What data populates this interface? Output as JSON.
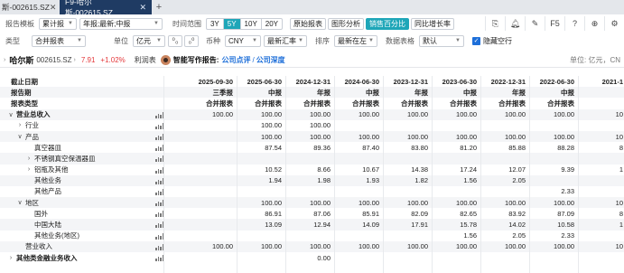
{
  "tabs": [
    {
      "label": "斯-002615.SZ",
      "active": false
    },
    {
      "label": "F9-哈尔斯-002615.SZ",
      "active": true
    }
  ],
  "toolbar1": {
    "report_template_label": "报告模板",
    "template_value": "累计报",
    "period_value": "年报;最新;中报",
    "time_range_label": "时间范围",
    "ranges": [
      "3Y",
      "5Y",
      "10Y",
      "20Y"
    ],
    "active_range": "5Y",
    "views": [
      "原始报表",
      "图形分析",
      "销售百分比",
      "同比增长率"
    ],
    "active_view": "销售百分比",
    "icons": [
      "save-icon",
      "bell-icon",
      "edit-icon",
      "F5",
      "help-icon",
      "plus-icon",
      "settings-icon"
    ],
    "f5_label": "F5"
  },
  "toolbar2": {
    "type_label": "类型",
    "type_value": "合并报表",
    "unit_label": "单位",
    "unit_value": "亿元",
    "currency_label": "币种",
    "currency_value": "CNY",
    "rate_value": "最新汇率",
    "sort_label": "排序",
    "sort_value": "最新在左",
    "format_label": "数据表格",
    "format_value": "默认",
    "hide_empty_label": "隐藏空行",
    "hide_empty_checked": true
  },
  "stock": {
    "name": "哈尔斯",
    "code": "002615.SZ",
    "price": "7.91",
    "change_pct": "+1.02%",
    "profit_table": "利润表",
    "ai_title": "智能写作报告:",
    "link1": "公司点评",
    "link2": "公司深度",
    "unit_text": "单位: 亿元，CN"
  },
  "table": {
    "columns": [
      "2025-09-30",
      "2025-06-30",
      "2024-12-31",
      "2024-06-30",
      "2023-12-31",
      "2023-06-30",
      "2022-12-31",
      "2022-06-30",
      "2021-1"
    ],
    "rows": [
      {
        "label": "截止日期",
        "header": true,
        "cells": [
          "2025-09-30",
          "2025-06-30",
          "2024-12-31",
          "2024-06-30",
          "2023-12-31",
          "2023-06-30",
          "2022-12-31",
          "2022-06-30",
          "2021-1"
        ]
      },
      {
        "label": "报告期",
        "header": true,
        "cells": [
          "三季报",
          "中报",
          "年报",
          "中报",
          "年报",
          "中报",
          "年报",
          "中报",
          ""
        ]
      },
      {
        "label": "报表类型",
        "header": true,
        "cells": [
          "合并报表",
          "合并报表",
          "合并报表",
          "合并报表",
          "合并报表",
          "合并报表",
          "合并报表",
          "合并报表",
          ""
        ]
      },
      {
        "label": "营业总收入",
        "indent": 0,
        "toggle": "∨",
        "bold": true,
        "bars": true,
        "cells": [
          "100.00",
          "100.00",
          "100.00",
          "100.00",
          "100.00",
          "100.00",
          "100.00",
          "100.00",
          "10"
        ]
      },
      {
        "label": "行业",
        "indent": 1,
        "toggle": "›",
        "bars": true,
        "cells": [
          "",
          "100.00",
          "100.00",
          "",
          "",
          "",
          "",
          "",
          ""
        ]
      },
      {
        "label": "产品",
        "indent": 1,
        "toggle": "∨",
        "bars": true,
        "cells": [
          "",
          "100.00",
          "100.00",
          "100.00",
          "100.00",
          "100.00",
          "100.00",
          "100.00",
          "10"
        ]
      },
      {
        "label": "真空器皿",
        "indent": 2,
        "bars": true,
        "cells": [
          "",
          "87.54",
          "89.36",
          "87.40",
          "83.80",
          "81.20",
          "85.88",
          "88.28",
          "8"
        ]
      },
      {
        "label": "不锈钢真空保温器皿",
        "indent": 2,
        "toggle": "›",
        "bars": true,
        "cells": [
          "",
          "",
          "",
          "",
          "",
          "",
          "",
          "",
          ""
        ]
      },
      {
        "label": "铝瓶及其他",
        "indent": 2,
        "toggle": "›",
        "bars": true,
        "cells": [
          "",
          "10.52",
          "8.66",
          "10.67",
          "14.38",
          "17.24",
          "12.07",
          "9.39",
          "1"
        ]
      },
      {
        "label": "其他业务",
        "indent": 2,
        "bars": true,
        "cells": [
          "",
          "1.94",
          "1.98",
          "1.93",
          "1.82",
          "1.56",
          "2.05",
          "",
          ""
        ]
      },
      {
        "label": "其他产品",
        "indent": 2,
        "bars": true,
        "cells": [
          "",
          "",
          "",
          "",
          "",
          "",
          "",
          "2.33",
          ""
        ]
      },
      {
        "label": "地区",
        "indent": 1,
        "toggle": "∨",
        "bars": true,
        "cells": [
          "",
          "100.00",
          "100.00",
          "100.00",
          "100.00",
          "100.00",
          "100.00",
          "100.00",
          "10"
        ]
      },
      {
        "label": "国外",
        "indent": 2,
        "bars": true,
        "cells": [
          "",
          "86.91",
          "87.06",
          "85.91",
          "82.09",
          "82.65",
          "83.92",
          "87.09",
          "8"
        ]
      },
      {
        "label": "中国大陆",
        "indent": 2,
        "bars": true,
        "cells": [
          "",
          "13.09",
          "12.94",
          "14.09",
          "17.91",
          "15.78",
          "14.02",
          "10.58",
          "1"
        ]
      },
      {
        "label": "其他业务(地区)",
        "indent": 2,
        "bars": true,
        "cells": [
          "",
          "",
          "",
          "",
          "",
          "1.56",
          "2.05",
          "2.33",
          ""
        ]
      },
      {
        "label": "营业收入",
        "indent": 1,
        "bars": true,
        "cells": [
          "100.00",
          "100.00",
          "100.00",
          "100.00",
          "100.00",
          "100.00",
          "100.00",
          "100.00",
          "10"
        ]
      },
      {
        "label": "其他类金融业务收入",
        "indent": 0,
        "toggle": "›",
        "bold": true,
        "bars": true,
        "cells": [
          "",
          "",
          "0.00",
          "",
          "",
          "",
          "",
          "",
          ""
        ]
      }
    ]
  }
}
